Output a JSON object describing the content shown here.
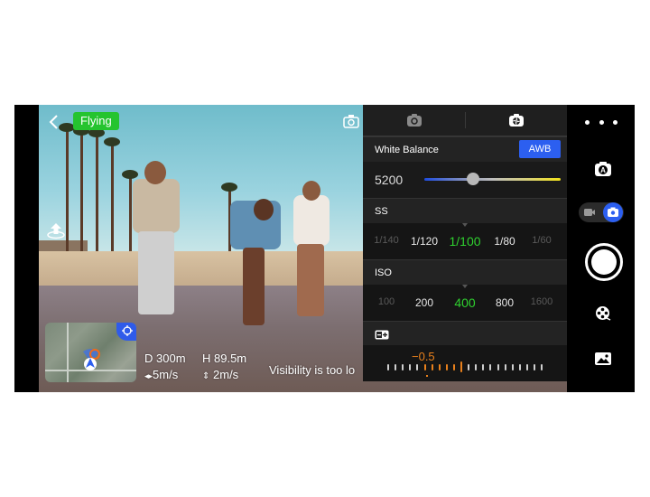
{
  "status": {
    "flight_state": "Flying",
    "flight_state_color": "#25c42f"
  },
  "telemetry": {
    "distance": "D 300m",
    "height": "H 89.5m",
    "horizontal_speed": "5m/s",
    "vertical_speed": "2m/s"
  },
  "warning": {
    "text": "Visibility is too lo"
  },
  "panel": {
    "tabs": [
      {
        "name": "camera-settings-tab",
        "icon": "gear-camera-icon",
        "active": false
      },
      {
        "name": "aperture-settings-tab",
        "icon": "shutter-icon",
        "active": true
      }
    ],
    "white_balance": {
      "label": "White Balance",
      "mode_button": "AWB",
      "value": "5200",
      "slider_fraction": 0.36
    },
    "shutter_speed": {
      "label": "SS",
      "options": [
        "1/140",
        "1/120",
        "1/100",
        "1/80",
        "1/60"
      ],
      "selected": "1/100"
    },
    "iso": {
      "label": "ISO",
      "options": [
        "100",
        "200",
        "400",
        "800",
        "1600"
      ],
      "selected": "400"
    },
    "exposure": {
      "icon": "exposure-compensation-icon",
      "value": "−0.5"
    }
  },
  "colors": {
    "accent_blue": "#2c5ff0",
    "selected_green": "#2fd12f",
    "exposure_orange": "#e8801c"
  }
}
